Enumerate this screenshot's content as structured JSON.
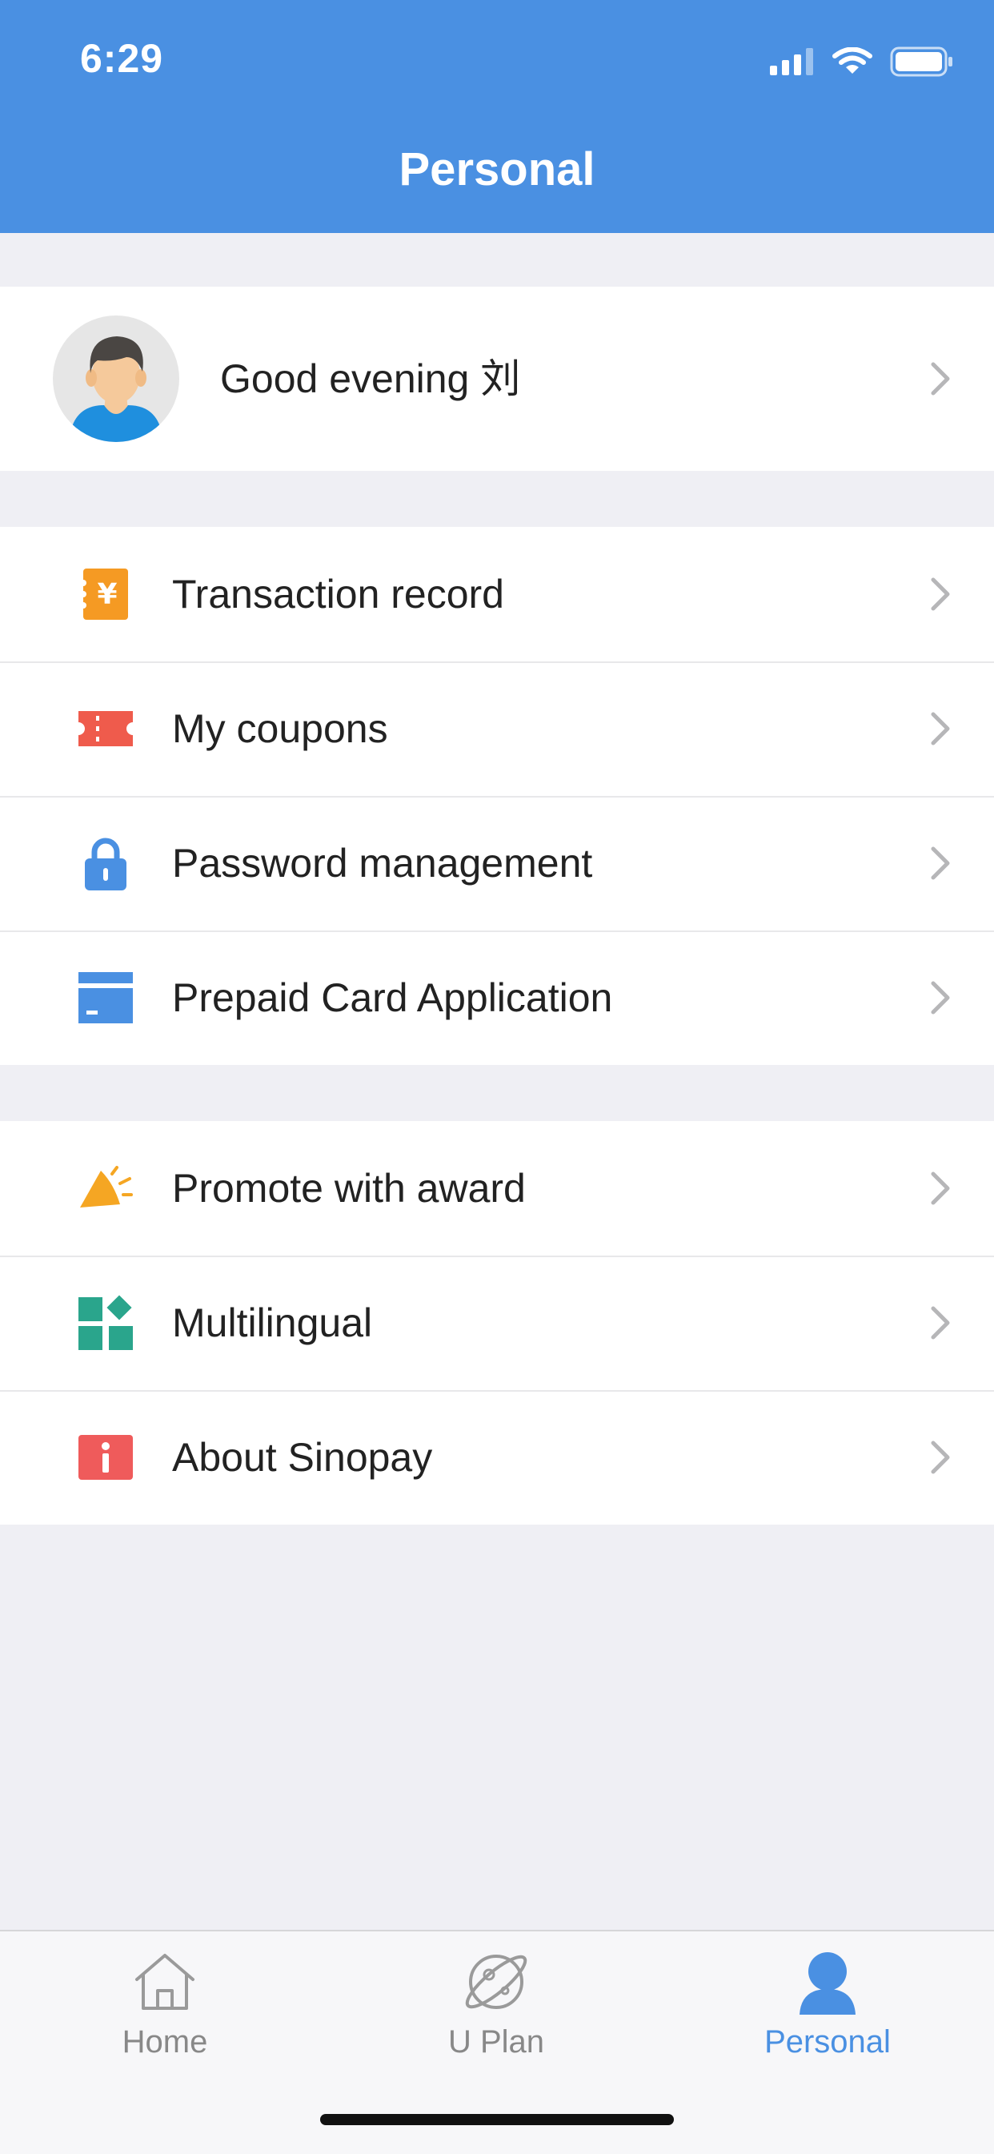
{
  "status_bar": {
    "time": "6:29"
  },
  "header": {
    "title": "Personal"
  },
  "profile": {
    "greeting": "Good evening 刘",
    "avatar_icon": "user-avatar"
  },
  "menu_group_1": [
    {
      "label": "Transaction record",
      "icon": "yuan-receipt-icon",
      "color": "#f59a23"
    },
    {
      "label": "My coupons",
      "icon": "ticket-icon",
      "color": "#ef5b4c"
    },
    {
      "label": "Password management",
      "icon": "lock-icon",
      "color": "#4a90e2"
    },
    {
      "label": "Prepaid Card Application",
      "icon": "card-icon",
      "color": "#4a90e2"
    }
  ],
  "menu_group_2": [
    {
      "label": "Promote with award",
      "icon": "megaphone-icon",
      "color": "#f5a623"
    },
    {
      "label": "Multilingual",
      "icon": "apps-grid-icon",
      "color": "#2aa58c"
    },
    {
      "label": "About Sinopay",
      "icon": "info-icon",
      "color": "#ef5b5b"
    }
  ],
  "tabbar": {
    "items": [
      {
        "label": "Home",
        "icon": "house-icon",
        "active": false
      },
      {
        "label": "U Plan",
        "icon": "planet-icon",
        "active": false
      },
      {
        "label": "Personal",
        "icon": "person-icon",
        "active": true
      }
    ]
  },
  "colors": {
    "primary": "#4a90e2",
    "background": "#efeff4"
  }
}
